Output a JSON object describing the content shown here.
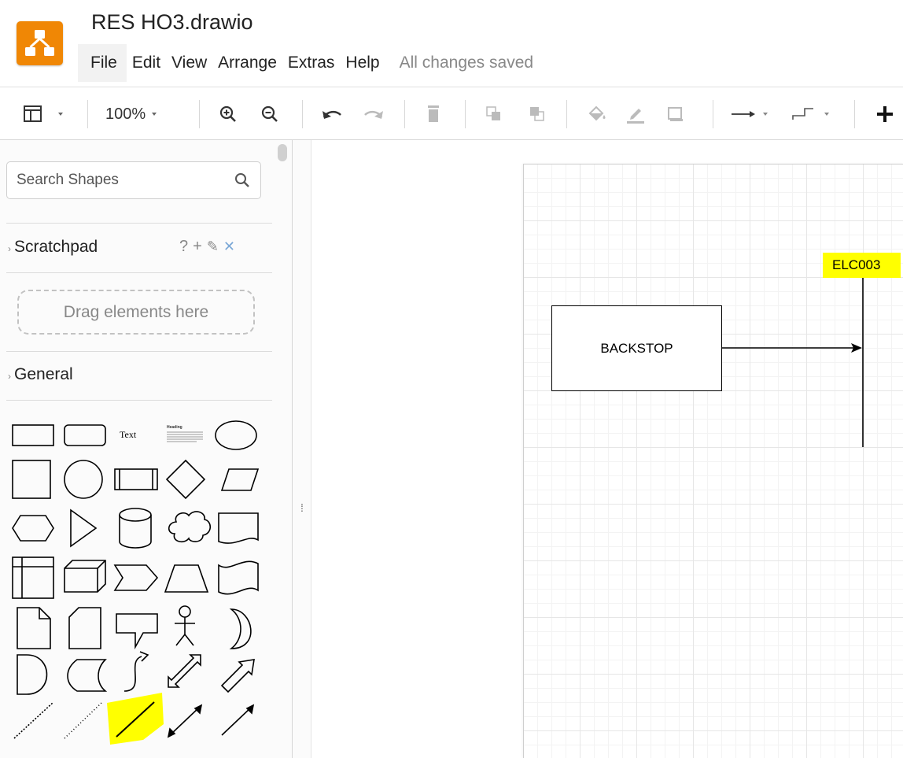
{
  "app": {
    "document_title": "RES HO3.drawio",
    "brand_color": "#f08705",
    "menu": [
      "File",
      "Edit",
      "View",
      "Arrange",
      "Extras",
      "Help"
    ],
    "save_status": "All changes saved"
  },
  "toolbar": {
    "zoom": "100%",
    "items": [
      "format-panel-icon",
      "zoom-in-icon",
      "zoom-out-icon",
      "undo-icon",
      "redo-icon",
      "delete-icon",
      "to-front-icon",
      "to-back-icon",
      "fill-color-icon",
      "line-color-icon",
      "shadow-icon",
      "connection-icon",
      "waypoints-icon",
      "insert-icon"
    ]
  },
  "sidebar": {
    "search_placeholder": "Search Shapes",
    "scratchpad": {
      "title": "Scratchpad",
      "actions": [
        "?",
        "+",
        "✎",
        "✕"
      ],
      "drop_zone_text": "Drag elements here"
    },
    "general": {
      "title": "General",
      "text_shape_label": "Text",
      "heading_shape_label": "Heading",
      "highlight_color": "#ffff00"
    }
  },
  "diagram": {
    "shapes": [
      {
        "id": "backstop",
        "label": "BACKSTOP"
      },
      {
        "id": "elc003",
        "label": "ELC003",
        "highlight": "#ffff00"
      }
    ]
  }
}
